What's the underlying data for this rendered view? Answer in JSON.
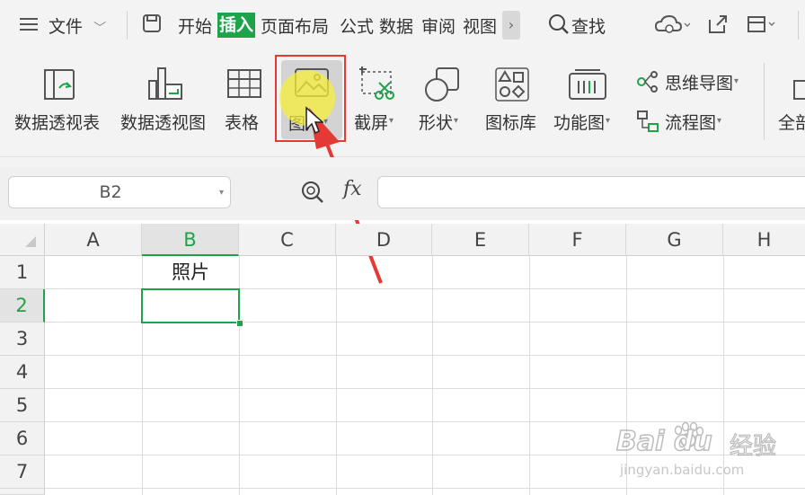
{
  "menubar": {
    "file_label": "文件",
    "tabs": [
      "开始",
      "插入",
      "页面布局",
      "公式",
      "数据",
      "审阅",
      "视图"
    ],
    "more_glyph": "›",
    "search_label": "查找"
  },
  "ribbon": {
    "buttons": [
      {
        "label": "数据透视表",
        "icon": "pivot-table-icon"
      },
      {
        "label": "数据透视图",
        "icon": "pivot-chart-icon"
      },
      {
        "label": "表格",
        "icon": "table-icon"
      },
      {
        "label": "图片",
        "icon": "picture-icon"
      },
      {
        "label": "截屏",
        "icon": "screenshot-icon"
      },
      {
        "label": "形状",
        "icon": "shapes-icon"
      },
      {
        "label": "图标库",
        "icon": "icon-library-icon"
      },
      {
        "label": "功能图",
        "icon": "function-chart-icon"
      }
    ],
    "mind_map_label": "思维导图",
    "flowchart_label": "流程图",
    "truncated_label": "全部"
  },
  "formula_bar": {
    "name_box_value": "B2",
    "fx_label": "fx",
    "formula_value": ""
  },
  "sheet": {
    "columns": [
      "A",
      "B",
      "C",
      "D",
      "E",
      "F",
      "G",
      "H"
    ],
    "rows": [
      "1",
      "2",
      "3",
      "4",
      "5",
      "6",
      "7"
    ],
    "cell_B1": "照片",
    "active_cell": "B2"
  },
  "watermark": {
    "brand": "Bai du",
    "suffix": "经验",
    "url": "jingyan.baidu.com"
  },
  "colors": {
    "accent_green": "#1fa34a",
    "highlight_red": "#e53935",
    "cursor_yellow": "#f5ef3a"
  }
}
